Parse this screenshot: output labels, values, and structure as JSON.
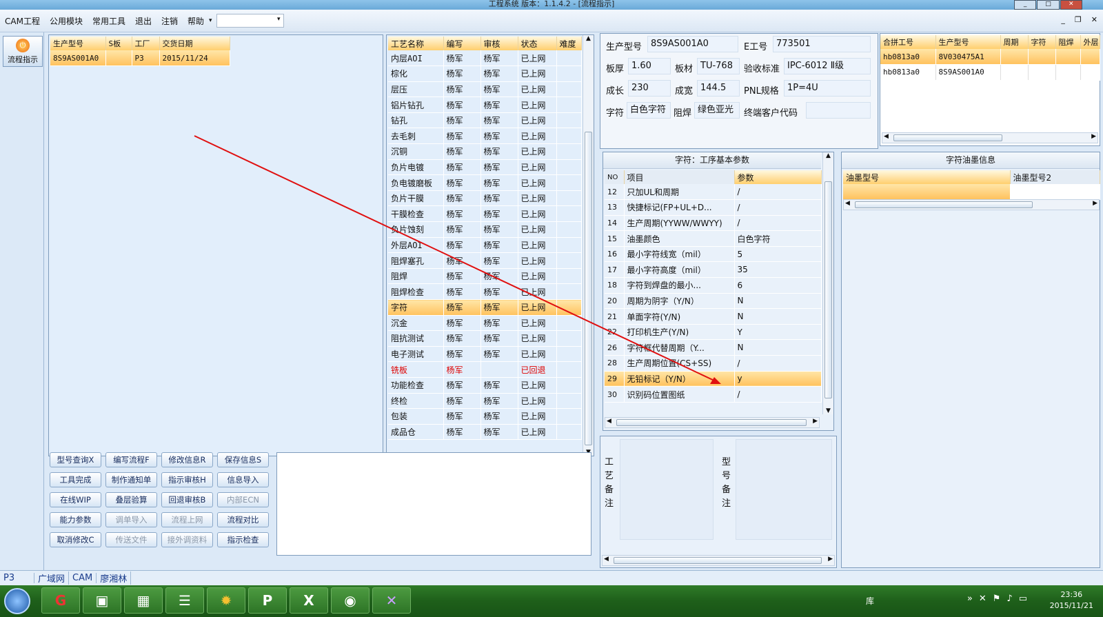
{
  "window": {
    "title": "工程系统   版本：1.1.4.2 - [流程指示]"
  },
  "menu": {
    "items": [
      "CAM工程",
      "公用模块",
      "常用工具",
      "退出",
      "注销",
      "帮助"
    ],
    "combo_value": ""
  },
  "sidebar": {
    "flow_button": "流程指示"
  },
  "orders": {
    "headers": [
      "生产型号",
      "S板",
      "工厂",
      "交货日期"
    ],
    "rows": [
      [
        "8S9AS001A0",
        "",
        "P3",
        "2015/11/24"
      ]
    ]
  },
  "processes": {
    "headers": [
      "工艺名称",
      "编写",
      "审核",
      "状态",
      "难度"
    ],
    "rows": [
      [
        "内层AOI",
        "杨军",
        "杨军",
        "已上网",
        ""
      ],
      [
        "棕化",
        "杨军",
        "杨军",
        "已上网",
        ""
      ],
      [
        "层压",
        "杨军",
        "杨军",
        "已上网",
        ""
      ],
      [
        "铝片钻孔",
        "杨军",
        "杨军",
        "已上网",
        ""
      ],
      [
        "钻孔",
        "杨军",
        "杨军",
        "已上网",
        ""
      ],
      [
        "去毛刺",
        "杨军",
        "杨军",
        "已上网",
        ""
      ],
      [
        "沉铜",
        "杨军",
        "杨军",
        "已上网",
        ""
      ],
      [
        "负片电镀",
        "杨军",
        "杨军",
        "已上网",
        ""
      ],
      [
        "负电镀磨板",
        "杨军",
        "杨军",
        "已上网",
        ""
      ],
      [
        "负片干膜",
        "杨军",
        "杨军",
        "已上网",
        ""
      ],
      [
        "干膜检查",
        "杨军",
        "杨军",
        "已上网",
        ""
      ],
      [
        "负片蚀刻",
        "杨军",
        "杨军",
        "已上网",
        ""
      ],
      [
        "外层AOI",
        "杨军",
        "杨军",
        "已上网",
        ""
      ],
      [
        "阻焊塞孔",
        "杨军",
        "杨军",
        "已上网",
        ""
      ],
      [
        "阻焊",
        "杨军",
        "杨军",
        "已上网",
        ""
      ],
      [
        "阻焊检查",
        "杨军",
        "杨军",
        "已上网",
        ""
      ],
      [
        "字符",
        "杨军",
        "杨军",
        "已上网",
        ""
      ],
      [
        "沉金",
        "杨军",
        "杨军",
        "已上网",
        ""
      ],
      [
        "阻抗测试",
        "杨军",
        "杨军",
        "已上网",
        ""
      ],
      [
        "电子测试",
        "杨军",
        "杨军",
        "已上网",
        ""
      ],
      [
        "铣板",
        "杨军",
        "",
        "已回退",
        ""
      ],
      [
        "功能检查",
        "杨军",
        "杨军",
        "已上网",
        ""
      ],
      [
        "终检",
        "杨军",
        "杨军",
        "已上网",
        ""
      ],
      [
        "包装",
        "杨军",
        "杨军",
        "已上网",
        ""
      ],
      [
        "成品仓",
        "杨军",
        "杨军",
        "已上网",
        ""
      ]
    ],
    "selected_index": 16,
    "returned_index": 20
  },
  "buttons": [
    [
      "型号查询X",
      "编写流程F",
      "修改信息R",
      "保存信息S"
    ],
    [
      "工具完成",
      "制作通知单",
      "指示审核H",
      "信息导入"
    ],
    [
      "在线WIP",
      "叠层验算",
      "回退审核B",
      "内部ECN"
    ],
    [
      "能力参数",
      "调单导入",
      "流程上网",
      "流程对比"
    ],
    [
      "取消修改C",
      "传送文件",
      "接外调资料",
      "指示检查"
    ]
  ],
  "disabled_buttons": [
    "内部ECN",
    "调单导入",
    "流程上网",
    "传送文件",
    "接外调资料"
  ],
  "info": {
    "model_label": "生产型号",
    "model": "8S9AS001A0",
    "eno_label": "E工号",
    "eno": "773501",
    "thick_label": "板厚",
    "thick": "1.60",
    "material_label": "板材",
    "material": "TU-768",
    "accept_label": "验收标准",
    "accept": "IPC-6012 Ⅱ级",
    "len_label": "成长",
    "len": "230",
    "width_label": "成宽",
    "width": "144.5",
    "pnl_label": "PNL规格",
    "pnl": "1P=4U",
    "char_label": "字符",
    "char": "白色字符",
    "mask_label": "阻焊",
    "mask": "绿色亚光",
    "cust_label": "终端客户代码",
    "cust": ""
  },
  "combine": {
    "headers": [
      "合拼工号",
      "生产型号",
      "周期",
      "字符",
      "阻焊",
      "外层"
    ],
    "rows": [
      [
        "hb0813a0",
        "8V030475A1",
        "",
        "",
        "",
        ""
      ],
      [
        "hb0813a0",
        "8S9AS001A0",
        "",
        "",
        "",
        ""
      ]
    ]
  },
  "params": {
    "title": "字符：工序基本参数",
    "headers": [
      "NO",
      "项目",
      "参数"
    ],
    "rows": [
      [
        "12",
        "只加UL和周期",
        "/"
      ],
      [
        "13",
        "快捷标记(FP+UL+D...",
        "/"
      ],
      [
        "14",
        "生产周期(YYWW/WWYY)",
        "/"
      ],
      [
        "15",
        "油墨颜色",
        "白色字符"
      ],
      [
        "16",
        "最小字符线宽（mil）",
        "5"
      ],
      [
        "17",
        "最小字符高度（mil）",
        "35"
      ],
      [
        "18",
        "字符到焊盘的最小...",
        "6"
      ],
      [
        "20",
        "周期为阴字（Y/N）",
        "N"
      ],
      [
        "21",
        "单面字符(Y/N)",
        "N"
      ],
      [
        "22",
        "打印机生产(Y/N)",
        "Y"
      ],
      [
        "26",
        "字符框代替周期（Y...",
        "N"
      ],
      [
        "28",
        "生产周期位置(CS+SS)",
        "/"
      ],
      [
        "29",
        "无铅标记（Y/N）",
        "y"
      ],
      [
        "30",
        "识别码位置图纸",
        "/"
      ]
    ],
    "selected_index": 12
  },
  "ink": {
    "title": "字符油墨信息",
    "headers": [
      "油墨型号",
      "油墨型号2"
    ]
  },
  "remarks": {
    "process_label": "工艺备注",
    "model_label": "型号备注"
  },
  "statusbar": {
    "items": [
      "P3",
      "广域网",
      "CAM",
      "廖湘林"
    ]
  },
  "taskbar": {
    "lib_label": "库",
    "time": "23:36",
    "date": "2015/11/21"
  },
  "colors": {
    "arrow": "#e01010",
    "selected_row": "#ffc25e",
    "taskbar": "#1e5f1a"
  }
}
